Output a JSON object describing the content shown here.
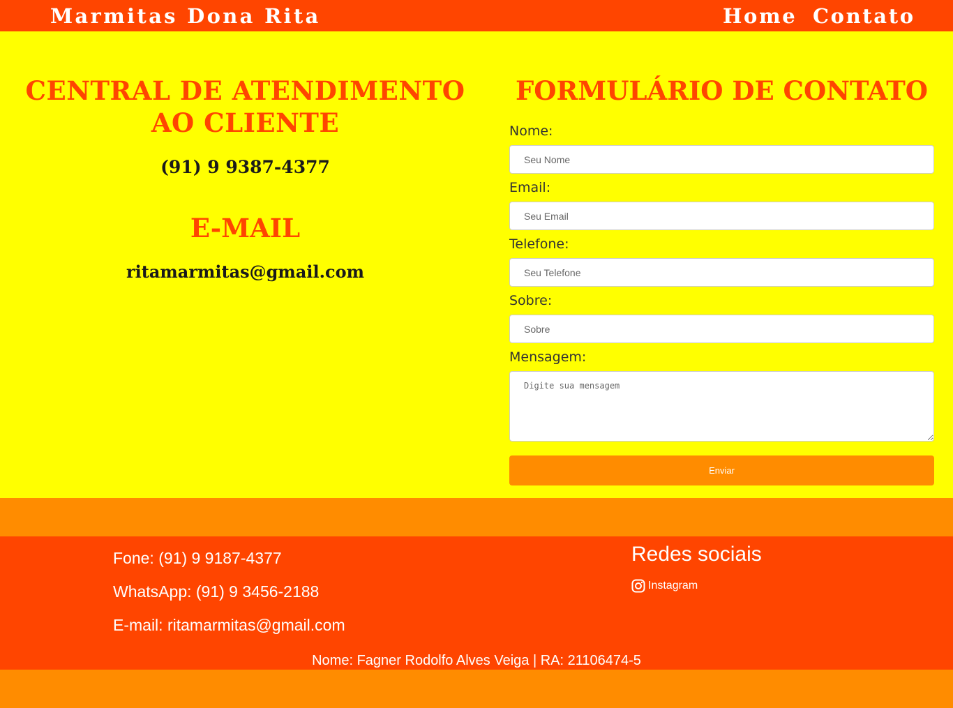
{
  "header": {
    "brand": "Marmitas Dona Rita",
    "nav": {
      "home": "Home",
      "contato": "Contato"
    }
  },
  "atendimento": {
    "title_line1": "CENTRAL DE ATENDIMENTO",
    "title_line2": "AO CLIENTE",
    "phone": "(91) 9 9387-4377",
    "email_title": "E-MAIL",
    "email": "ritamarmitas@gmail.com"
  },
  "form": {
    "title": "FORMULÁRIO DE CONTATO",
    "fields": {
      "nome": {
        "label": "Nome:",
        "placeholder": "Seu Nome",
        "value": ""
      },
      "email": {
        "label": "Email:",
        "placeholder": "Seu Email",
        "value": ""
      },
      "telefone": {
        "label": "Telefone:",
        "placeholder": "Seu Telefone",
        "value": ""
      },
      "sobre": {
        "label": "Sobre:",
        "placeholder": "Sobre",
        "value": ""
      },
      "mensagem": {
        "label": "Mensagem:",
        "placeholder": "Digite sua mensagem",
        "value": ""
      }
    },
    "submit_label": "Enviar"
  },
  "footer": {
    "fone": "Fone: (91) 9 9187-4377",
    "whatsapp": "WhatsApp: (91) 9 3456-2188",
    "email": "E-mail: ritamarmitas@gmail.com",
    "social_title": "Redes sociais",
    "social_links": [
      {
        "label": "Instagram",
        "icon": "instagram-icon"
      }
    ],
    "credit": "Nome: Fagner Rodolfo Alves Veiga | RA: 21106474-5"
  },
  "colors": {
    "header_bg": "#ff4500",
    "main_bg": "#ffff00",
    "accent_orange": "#ff8c00",
    "heading_red": "#ff4500",
    "text_dark": "#1a1a1a",
    "white": "#ffffff"
  }
}
